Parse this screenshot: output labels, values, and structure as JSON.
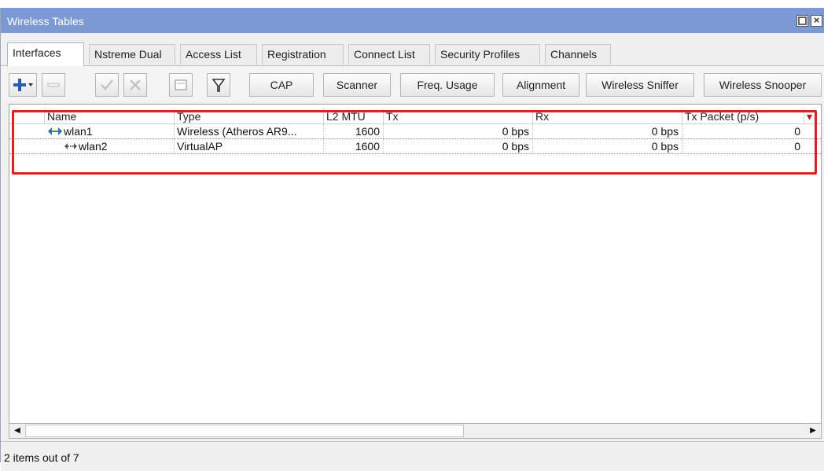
{
  "window": {
    "title": "Wireless Tables"
  },
  "tabs": [
    {
      "label": "Interfaces",
      "active": true
    },
    {
      "label": "Nstreme Dual"
    },
    {
      "label": "Access List"
    },
    {
      "label": "Registration"
    },
    {
      "label": "Connect List"
    },
    {
      "label": "Security Profiles"
    },
    {
      "label": "Channels"
    }
  ],
  "toolbar": {
    "add_icon": "plus-icon",
    "remove_icon": "minus-icon",
    "enable_icon": "check-icon",
    "disable_icon": "x-icon",
    "comment_icon": "note-icon",
    "filter_icon": "filter-icon",
    "buttons": [
      "CAP",
      "Scanner",
      "Freq. Usage",
      "Alignment",
      "Wireless Sniffer",
      "Wireless Snooper"
    ]
  },
  "table": {
    "columns": [
      "Name",
      "Type",
      "L2 MTU",
      "Tx",
      "Rx",
      "Tx Packet (p/s)"
    ],
    "rows": [
      {
        "name": "wlan1",
        "type": "Wireless (Atheros AR9...",
        "l2mtu": "1600",
        "tx": "0 bps",
        "rx": "0 bps",
        "txp": "0"
      },
      {
        "name": "wlan2",
        "type": "VirtualAP",
        "l2mtu": "1600",
        "tx": "0 bps",
        "rx": "0 bps",
        "txp": "0"
      }
    ]
  },
  "status": {
    "text": "2 items out of 7"
  },
  "colors": {
    "title_bar": "#7c99d3",
    "highlight": "#e01e24",
    "add_button": "#2a5db0"
  }
}
